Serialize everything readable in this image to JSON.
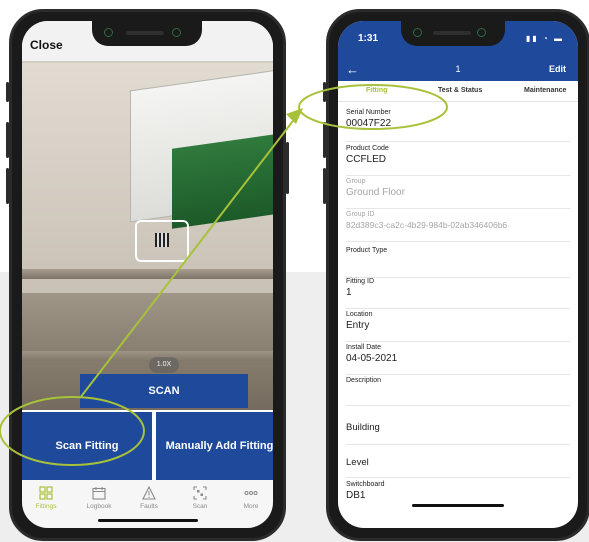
{
  "left_phone": {
    "close_label": "Close",
    "zoom_label": "1.0X",
    "scan_label": "SCAN",
    "scan_fitting_label": "Scan Fitting",
    "manual_add_label": "Manually Add Fitting",
    "tabs": [
      {
        "label": "Fittings",
        "icon": "grid-icon"
      },
      {
        "label": "Logbook",
        "icon": "calendar-icon"
      },
      {
        "label": "Faults",
        "icon": "warning-icon"
      },
      {
        "label": "Scan",
        "icon": "qr-scan-icon"
      },
      {
        "label": "More",
        "icon": "more-icon"
      }
    ]
  },
  "right_phone": {
    "time": "1:31",
    "page_number": "1",
    "edit_label": "Edit",
    "sub_tabs": [
      "Fitting",
      "Test & Status",
      "Maintenance"
    ],
    "fields": [
      {
        "label": "Serial Number",
        "value": "00047F22"
      },
      {
        "label": "Product Code",
        "value": "CCFLED"
      },
      {
        "label": "Group",
        "value": "Ground Floor"
      },
      {
        "label": "Group ID",
        "value": "82d389c3-ca2c-4b29-984b-02ab346406b6"
      },
      {
        "label": "Product Type",
        "value": ""
      },
      {
        "label": "Fitting ID",
        "value": "1"
      },
      {
        "label": "Location",
        "value": "Entry"
      },
      {
        "label": "Install Date",
        "value": "04-05-2021"
      },
      {
        "label": "Description",
        "value": ""
      },
      {
        "label": "Building",
        "value": ""
      },
      {
        "label": "Level",
        "value": ""
      },
      {
        "label": "Switchboard",
        "value": "DB1"
      }
    ]
  },
  "colors": {
    "brand_blue": "#1f4a9c",
    "accent_green": "#a7c23a"
  }
}
